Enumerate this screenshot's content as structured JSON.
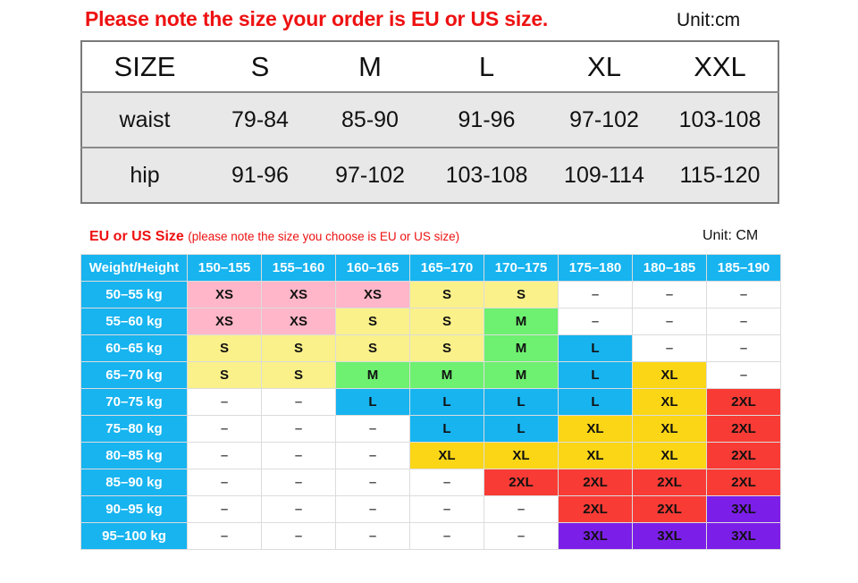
{
  "notice": {
    "text": "Please note the size your order is EU or US size.",
    "unit_label": "Unit:cm",
    "color": "#ee1111"
  },
  "size_table": {
    "columns": [
      "SIZE",
      "S",
      "M",
      "L",
      "XL",
      "XXL"
    ],
    "rows": [
      {
        "label": "waist",
        "values": [
          "79-84",
          "85-90",
          "91-96",
          "97-102",
          "103-108"
        ]
      },
      {
        "label": "hip",
        "values": [
          "91-96",
          "97-102",
          "103-108",
          "109-114",
          "115-120"
        ]
      }
    ]
  },
  "matrix": {
    "caption_strong": "EU or US Size",
    "caption_note": "(please note the size you choose is EU or US size)",
    "unit_label": "Unit: CM",
    "corner_label": "Weight/Height",
    "height_columns": [
      "150–155",
      "155–160",
      "160–165",
      "165–170",
      "170–175",
      "175–180",
      "180–185",
      "185–190"
    ],
    "weight_rows": [
      "50–55 kg",
      "55–60 kg",
      "60–65 kg",
      "65–70 kg",
      "70–75 kg",
      "75–80 kg",
      "80–85 kg",
      "85–90 kg",
      "90–95 kg",
      "95–100 kg"
    ],
    "empty_symbol": "–",
    "colors": {
      "header_blue": "#17b4f0",
      "pink": "#ffb6c8",
      "light_yellow": "#faf18a",
      "green": "#6ef070",
      "blue": "#17b4f0",
      "gold": "#fad616",
      "red": "#f93b35",
      "purple": "#7b1fe8",
      "empty": "#ffffff"
    },
    "cells": [
      [
        {
          "v": "XS",
          "c": "pink"
        },
        {
          "v": "XS",
          "c": "pink"
        },
        {
          "v": "XS",
          "c": "pink"
        },
        {
          "v": "S",
          "c": "light_yellow"
        },
        {
          "v": "S",
          "c": "light_yellow"
        },
        {
          "v": "–",
          "c": "empty"
        },
        {
          "v": "–",
          "c": "empty"
        },
        {
          "v": "–",
          "c": "empty"
        }
      ],
      [
        {
          "v": "XS",
          "c": "pink"
        },
        {
          "v": "XS",
          "c": "pink"
        },
        {
          "v": "S",
          "c": "light_yellow"
        },
        {
          "v": "S",
          "c": "light_yellow"
        },
        {
          "v": "M",
          "c": "green"
        },
        {
          "v": "–",
          "c": "empty"
        },
        {
          "v": "–",
          "c": "empty"
        },
        {
          "v": "–",
          "c": "empty"
        }
      ],
      [
        {
          "v": "S",
          "c": "light_yellow"
        },
        {
          "v": "S",
          "c": "light_yellow"
        },
        {
          "v": "S",
          "c": "light_yellow"
        },
        {
          "v": "S",
          "c": "light_yellow"
        },
        {
          "v": "M",
          "c": "green"
        },
        {
          "v": "L",
          "c": "blue"
        },
        {
          "v": "–",
          "c": "empty"
        },
        {
          "v": "–",
          "c": "empty"
        }
      ],
      [
        {
          "v": "S",
          "c": "light_yellow"
        },
        {
          "v": "S",
          "c": "light_yellow"
        },
        {
          "v": "M",
          "c": "green"
        },
        {
          "v": "M",
          "c": "green"
        },
        {
          "v": "M",
          "c": "green"
        },
        {
          "v": "L",
          "c": "blue"
        },
        {
          "v": "XL",
          "c": "gold"
        },
        {
          "v": "–",
          "c": "empty"
        }
      ],
      [
        {
          "v": "–",
          "c": "empty"
        },
        {
          "v": "–",
          "c": "empty"
        },
        {
          "v": "L",
          "c": "blue"
        },
        {
          "v": "L",
          "c": "blue"
        },
        {
          "v": "L",
          "c": "blue"
        },
        {
          "v": "L",
          "c": "blue"
        },
        {
          "v": "XL",
          "c": "gold"
        },
        {
          "v": "2XL",
          "c": "red"
        }
      ],
      [
        {
          "v": "–",
          "c": "empty"
        },
        {
          "v": "–",
          "c": "empty"
        },
        {
          "v": "–",
          "c": "empty"
        },
        {
          "v": "L",
          "c": "blue"
        },
        {
          "v": "L",
          "c": "blue"
        },
        {
          "v": "XL",
          "c": "gold"
        },
        {
          "v": "XL",
          "c": "gold"
        },
        {
          "v": "2XL",
          "c": "red"
        }
      ],
      [
        {
          "v": "–",
          "c": "empty"
        },
        {
          "v": "–",
          "c": "empty"
        },
        {
          "v": "–",
          "c": "empty"
        },
        {
          "v": "XL",
          "c": "gold"
        },
        {
          "v": "XL",
          "c": "gold"
        },
        {
          "v": "XL",
          "c": "gold"
        },
        {
          "v": "XL",
          "c": "gold"
        },
        {
          "v": "2XL",
          "c": "red"
        }
      ],
      [
        {
          "v": "–",
          "c": "empty"
        },
        {
          "v": "–",
          "c": "empty"
        },
        {
          "v": "–",
          "c": "empty"
        },
        {
          "v": "–",
          "c": "empty"
        },
        {
          "v": "2XL",
          "c": "red"
        },
        {
          "v": "2XL",
          "c": "red"
        },
        {
          "v": "2XL",
          "c": "red"
        },
        {
          "v": "2XL",
          "c": "red"
        }
      ],
      [
        {
          "v": "–",
          "c": "empty"
        },
        {
          "v": "–",
          "c": "empty"
        },
        {
          "v": "–",
          "c": "empty"
        },
        {
          "v": "–",
          "c": "empty"
        },
        {
          "v": "–",
          "c": "empty"
        },
        {
          "v": "2XL",
          "c": "red"
        },
        {
          "v": "2XL",
          "c": "red"
        },
        {
          "v": "3XL",
          "c": "purple"
        }
      ],
      [
        {
          "v": "–",
          "c": "empty"
        },
        {
          "v": "–",
          "c": "empty"
        },
        {
          "v": "–",
          "c": "empty"
        },
        {
          "v": "–",
          "c": "empty"
        },
        {
          "v": "–",
          "c": "empty"
        },
        {
          "v": "3XL",
          "c": "purple"
        },
        {
          "v": "3XL",
          "c": "purple"
        },
        {
          "v": "3XL",
          "c": "purple"
        }
      ]
    ]
  }
}
